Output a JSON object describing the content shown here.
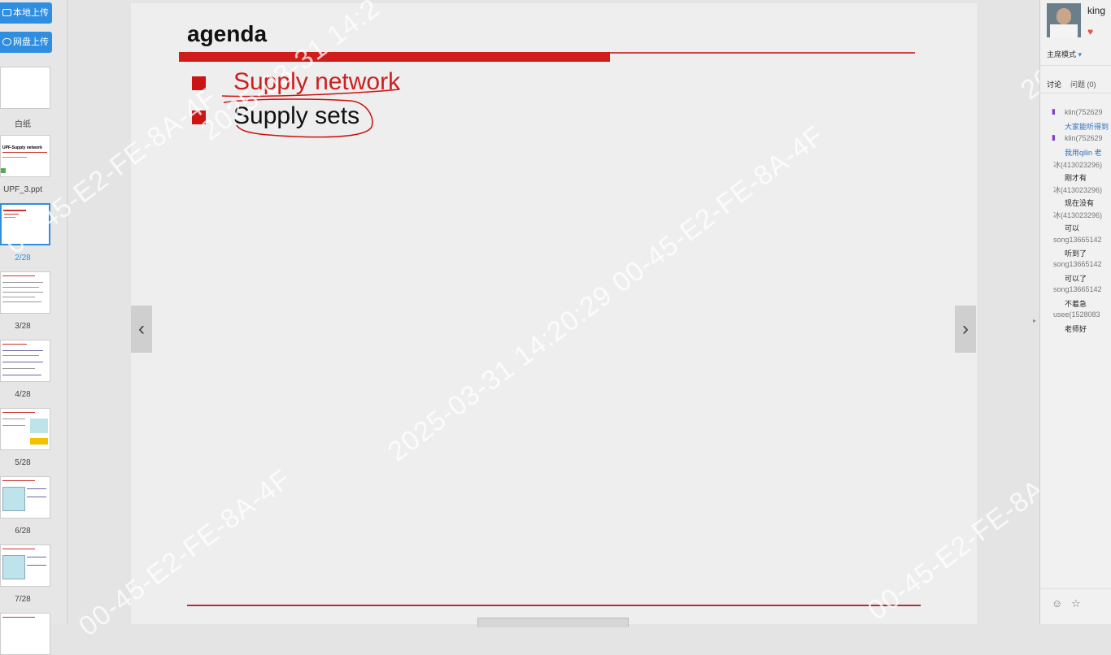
{
  "sidebar": {
    "upload_local": "本地上传",
    "upload_cloud": "网盘上传",
    "thumbs": [
      {
        "label": "白纸"
      },
      {
        "label": "UPF_3.ppt"
      },
      {
        "label": "2/28"
      },
      {
        "label": "3/28"
      },
      {
        "label": "4/28"
      },
      {
        "label": "5/28"
      },
      {
        "label": "6/28"
      },
      {
        "label": "7/28"
      }
    ],
    "thumb2_text": "UPF-Supply network"
  },
  "slide": {
    "title": "agenda",
    "bullets": [
      "Supply network",
      "Supply sets"
    ]
  },
  "nav": {
    "prev": "‹",
    "next": "›"
  },
  "watermark": {
    "lines": [
      "2025-03-31  14:20:29  00-45-E2-FE-8A-4F",
      "00-45-E2-FE-8A-4F",
      "00-45-E2-FE-8A-4F",
      "00-45-E2-FE-8A-4F",
      "2025-03-31  14:2",
      "2025-03-31"
    ]
  },
  "right_panel": {
    "user": "king",
    "mode": "主席模式",
    "tab_discuss": "讨论",
    "tab_question": "问题",
    "question_count": "(0)",
    "chat": [
      {
        "name": "klin(752629",
        "msg": "大家能听得到"
      },
      {
        "name": "klin(752629",
        "msg": "我用qilin 老"
      },
      {
        "name": "冰(413023296)",
        "msg": "刚才有"
      },
      {
        "name": "冰(413023296)",
        "msg": "现在没有"
      },
      {
        "name": "冰(413023296)",
        "msg": "可以"
      },
      {
        "name": "song13665142",
        "msg": "听到了"
      },
      {
        "name": "song13665142",
        "msg": "可以了"
      },
      {
        "name": "song13665142",
        "msg": "不着急"
      },
      {
        "name": "usee(1528083",
        "msg": "老师好"
      }
    ]
  },
  "colors": {
    "accent": "#2f8ee0",
    "slide_red": "#d11c1c"
  }
}
